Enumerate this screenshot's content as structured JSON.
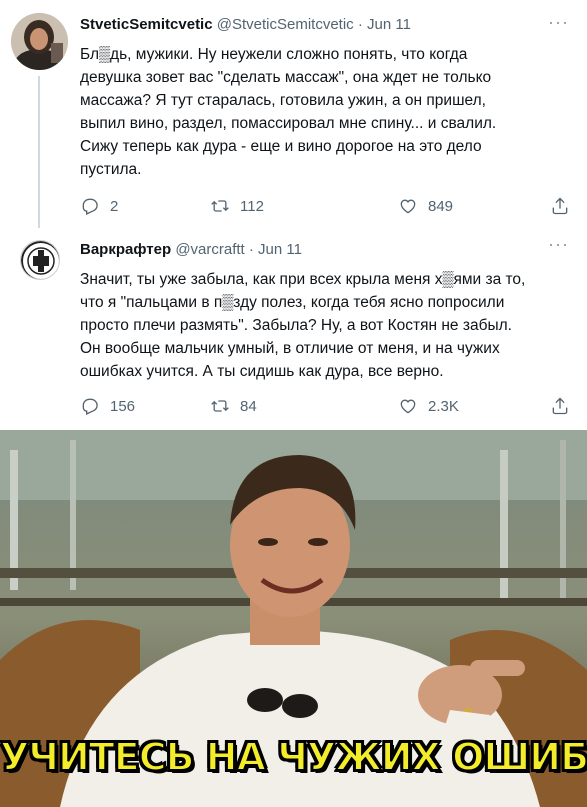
{
  "tweets": [
    {
      "name": "StveticSemitcvetic",
      "meta": "@StveticSemitcvetic · Jun 11",
      "text": "Бл▒дь, мужики. Ну неужели сложно понять, что когда\nдевушка зовет вас \"сделать массаж\", она ждет не только\nмассажа? Я тут старалась, готовила ужин, а он пришел,\nвыпил вино, раздел, помассировал мне спину... и свалил.\nСижу теперь как дура - еще и вино дорогое на это дело\nпустила.",
      "replies": "2",
      "retweets": "112",
      "likes": "849"
    },
    {
      "name": "Варкрафтер",
      "meta": "@varcraftt · Jun 11",
      "text": "Значит, ты уже забыла, как при всех крыла меня х▒ями за то,\nчто я \"пальцами в п▒зду полез, когда тебя ясно попросили\nпросто плечи размять\". Забыла? Ну, а вот Костян не забыл.\nОн вообще мальчик умный, в отличие от меня, и на чужих\nошибках учится. А ты сидишь как дура, все верно.",
      "replies": "156",
      "retweets": "84",
      "likes": "2.3K"
    }
  ],
  "icons": {
    "reply": "reply-icon",
    "retweet": "retweet-icon",
    "like": "heart-icon",
    "share": "share-icon",
    "more": "more-icon"
  },
  "meme": {
    "caption": "УЧИТЕСЬ НА ЧУЖИХ ОШИБКАХ"
  },
  "colors": {
    "secondary_text": "#536471",
    "caption_fill": "#f2ec2a"
  }
}
